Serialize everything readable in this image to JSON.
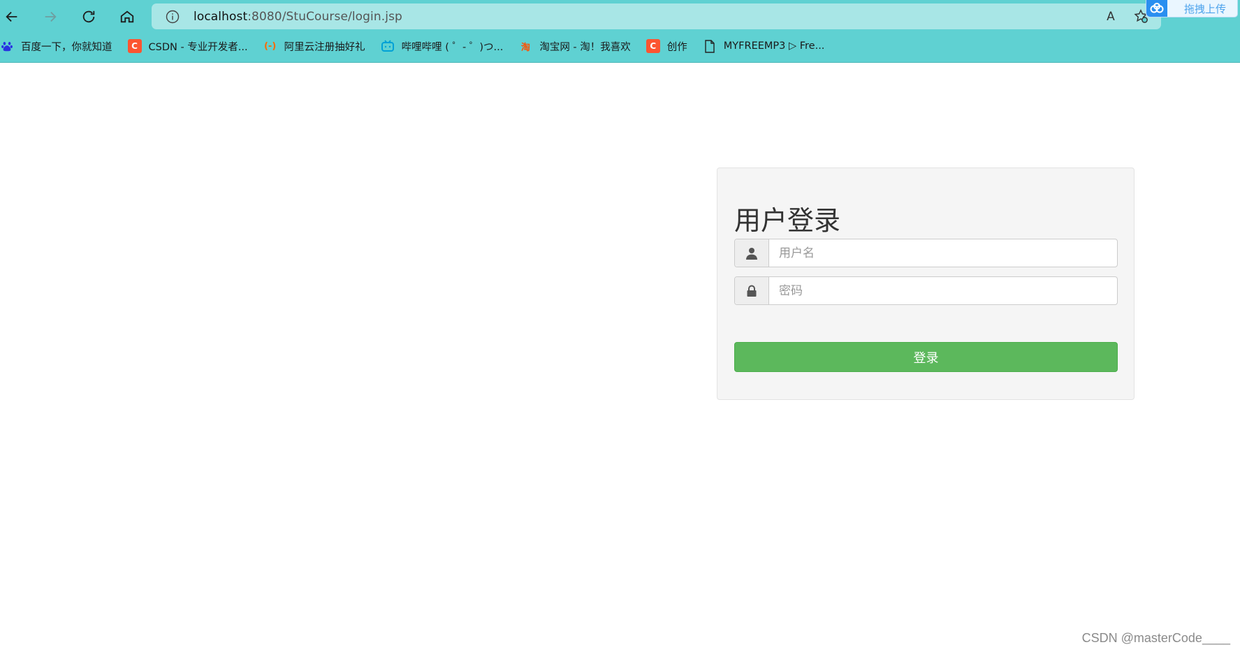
{
  "browser": {
    "url_host": "localhost",
    "url_rest": ":8080/StuCourse/login.jsp",
    "read_aloud": "A",
    "upload_label": "拖拽上传"
  },
  "bookmarks": [
    {
      "label": "百度一下，你就知道",
      "icon": "baidu-paw-icon"
    },
    {
      "label": "CSDN - 专业开发者...",
      "icon": "csdn-icon",
      "glyph": "C"
    },
    {
      "label": "阿里云注册抽好礼",
      "icon": "aliyun-icon",
      "glyph": "(-)"
    },
    {
      "label": "哔哩哔哩 ( ゜- ゜)つ...",
      "icon": "bilibili-icon"
    },
    {
      "label": "淘宝网 - 淘！我喜欢",
      "icon": "taobao-icon",
      "glyph": "淘"
    },
    {
      "label": "创作",
      "icon": "csdn-icon",
      "glyph": "C"
    },
    {
      "label": "MYFREEMP3 ▷ Fre...",
      "icon": "page-icon"
    }
  ],
  "login": {
    "title": "用户登录",
    "username_placeholder": "用户名",
    "password_placeholder": "密码",
    "submit_label": "登录"
  },
  "watermark": "CSDN @masterCode____",
  "colors": {
    "chrome": "#5fd1d2",
    "address_bar": "#a8e6e6",
    "panel_bg": "#f5f5f5",
    "button": "#5cb85c"
  }
}
